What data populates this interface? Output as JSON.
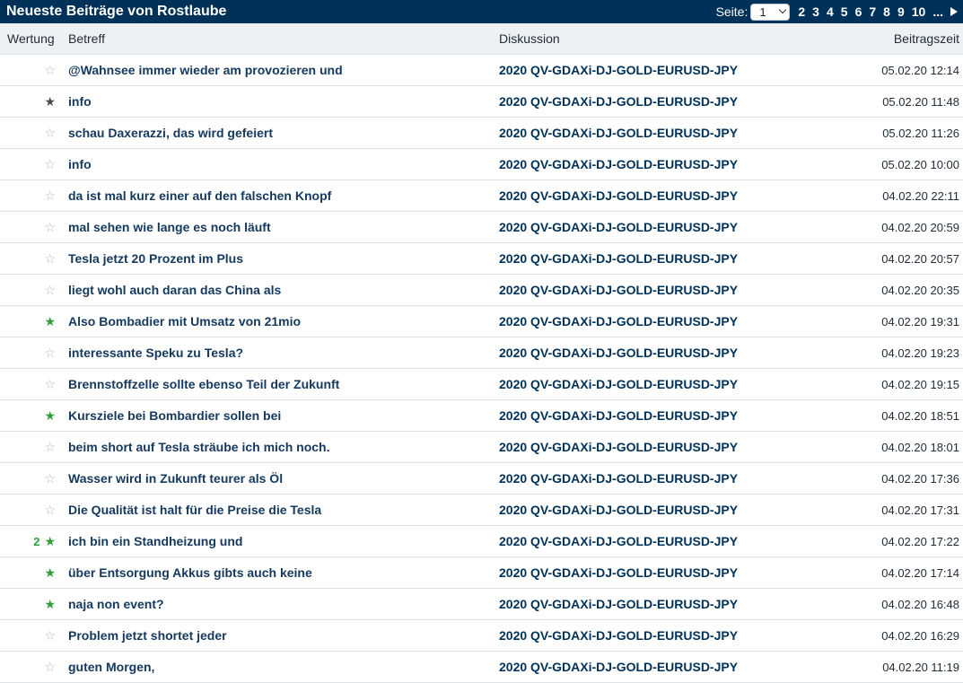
{
  "header": {
    "title": "Neueste Beiträge von Rostlaube",
    "pager": {
      "label": "Seite:",
      "current": "1",
      "pages": [
        "2",
        "3",
        "4",
        "5",
        "6",
        "7",
        "8",
        "9",
        "10"
      ],
      "ellipsis": "..."
    }
  },
  "columns": {
    "rating": "Wertung",
    "subject": "Betreff",
    "discussion": "Diskussion",
    "time": "Beitragszeit"
  },
  "colors": {
    "header_bg": "#003158",
    "star_green": "#2e9e38",
    "star_empty": "#b5b9bd",
    "star_dark": "#4a4a4a"
  },
  "rows": [
    {
      "rating": "empty",
      "count": "",
      "subject": "@Wahnsee immer wieder am provozieren und",
      "discussion": "2020 QV-GDAXi-DJ-GOLD-EURUSD-JPY",
      "time": "05.02.20 12:14"
    },
    {
      "rating": "dark",
      "count": "",
      "subject": "info",
      "discussion": "2020 QV-GDAXi-DJ-GOLD-EURUSD-JPY",
      "time": "05.02.20 11:48"
    },
    {
      "rating": "empty",
      "count": "",
      "subject": "schau Daxerazzi, das wird gefeiert",
      "discussion": "2020 QV-GDAXi-DJ-GOLD-EURUSD-JPY",
      "time": "05.02.20 11:26"
    },
    {
      "rating": "empty",
      "count": "",
      "subject": "info",
      "discussion": "2020 QV-GDAXi-DJ-GOLD-EURUSD-JPY",
      "time": "05.02.20 10:00"
    },
    {
      "rating": "empty",
      "count": "",
      "subject": "da ist mal kurz einer auf den falschen Knopf",
      "discussion": "2020 QV-GDAXi-DJ-GOLD-EURUSD-JPY",
      "time": "04.02.20 22:11"
    },
    {
      "rating": "empty",
      "count": "",
      "subject": "mal sehen wie lange es noch läuft",
      "discussion": "2020 QV-GDAXi-DJ-GOLD-EURUSD-JPY",
      "time": "04.02.20 20:59"
    },
    {
      "rating": "empty",
      "count": "",
      "subject": "Tesla jetzt 20 Prozent im Plus",
      "discussion": "2020 QV-GDAXi-DJ-GOLD-EURUSD-JPY",
      "time": "04.02.20 20:57"
    },
    {
      "rating": "empty",
      "count": "",
      "subject": "liegt wohl auch daran das China als",
      "discussion": "2020 QV-GDAXi-DJ-GOLD-EURUSD-JPY",
      "time": "04.02.20 20:35"
    },
    {
      "rating": "green",
      "count": "",
      "subject": "Also Bombadier mit Umsatz von 21mio",
      "discussion": "2020 QV-GDAXi-DJ-GOLD-EURUSD-JPY",
      "time": "04.02.20 19:31"
    },
    {
      "rating": "empty",
      "count": "",
      "subject": "interessante Speku zu Tesla?",
      "discussion": "2020 QV-GDAXi-DJ-GOLD-EURUSD-JPY",
      "time": "04.02.20 19:23"
    },
    {
      "rating": "empty",
      "count": "",
      "subject": "Brennstoffzelle sollte ebenso Teil der Zukunft",
      "discussion": "2020 QV-GDAXi-DJ-GOLD-EURUSD-JPY",
      "time": "04.02.20 19:15"
    },
    {
      "rating": "green",
      "count": "",
      "subject": "Kursziele bei Bombardier sollen bei",
      "discussion": "2020 QV-GDAXi-DJ-GOLD-EURUSD-JPY",
      "time": "04.02.20 18:51"
    },
    {
      "rating": "empty",
      "count": "",
      "subject": "beim short auf Tesla sträube ich mich noch.",
      "discussion": "2020 QV-GDAXi-DJ-GOLD-EURUSD-JPY",
      "time": "04.02.20 18:01"
    },
    {
      "rating": "empty",
      "count": "",
      "subject": "Wasser wird in Zukunft teurer als Öl",
      "discussion": "2020 QV-GDAXi-DJ-GOLD-EURUSD-JPY",
      "time": "04.02.20 17:36"
    },
    {
      "rating": "empty",
      "count": "",
      "subject": "Die Qualität ist halt für die Preise die Tesla",
      "discussion": "2020 QV-GDAXi-DJ-GOLD-EURUSD-JPY",
      "time": "04.02.20 17:31"
    },
    {
      "rating": "green",
      "count": "2",
      "subject": "ich bin ein Standheizung und",
      "discussion": "2020 QV-GDAXi-DJ-GOLD-EURUSD-JPY",
      "time": "04.02.20 17:22"
    },
    {
      "rating": "green",
      "count": "",
      "subject": "über Entsorgung Akkus gibts auch keine",
      "discussion": "2020 QV-GDAXi-DJ-GOLD-EURUSD-JPY",
      "time": "04.02.20 17:14"
    },
    {
      "rating": "green",
      "count": "",
      "subject": "naja non event?",
      "discussion": "2020 QV-GDAXi-DJ-GOLD-EURUSD-JPY",
      "time": "04.02.20 16:48"
    },
    {
      "rating": "empty",
      "count": "",
      "subject": "Problem jetzt shortet jeder",
      "discussion": "2020 QV-GDAXi-DJ-GOLD-EURUSD-JPY",
      "time": "04.02.20 16:29"
    },
    {
      "rating": "empty",
      "count": "",
      "subject": "guten Morgen,",
      "discussion": "2020 QV-GDAXi-DJ-GOLD-EURUSD-JPY",
      "time": "04.02.20 11:19"
    }
  ]
}
